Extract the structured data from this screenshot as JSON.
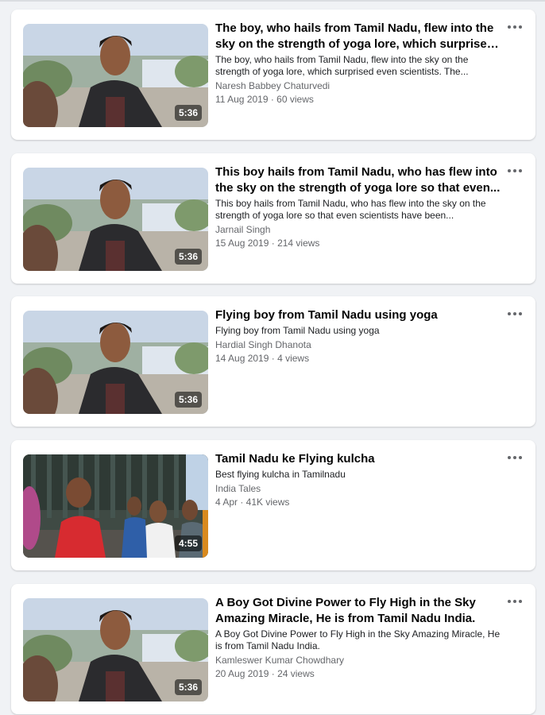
{
  "videos": [
    {
      "title": "The boy, who hails from Tamil Nadu, flew into the sky on the strength of yoga lore, which surprised even...",
      "description": "The boy, who hails from Tamil Nadu, flew into the sky on the strength of yoga lore, which surprised even scientists. The...",
      "author": "Naresh Babbey Chaturvedi",
      "meta": "11 Aug 2019 · 60 views",
      "duration": "5:36"
    },
    {
      "title": "This boy hails from Tamil Nadu, who has flew into the sky on the strength of yoga lore so that even...",
      "description": "This boy hails from Tamil Nadu, who has flew into the sky on the strength of yoga lore so that even scientists have been...",
      "author": "Jarnail Singh",
      "meta": "15 Aug 2019 · 214 views",
      "duration": "5:36"
    },
    {
      "title": "Flying boy from Tamil Nadu using yoga",
      "description": "Flying boy from Tamil Nadu using yoga",
      "author": "Hardial Singh Dhanota",
      "meta": "14 Aug 2019 · 4 views",
      "duration": "5:36"
    },
    {
      "title": "Tamil Nadu ke Flying kulcha",
      "description": "Best flying kulcha in Tamilnadu",
      "author": "India Tales",
      "meta": "4 Apr · 41K views",
      "duration": "4:55"
    },
    {
      "title": "A Boy Got Divine Power to Fly High in the Sky Amazing Miracle, He is from Tamil Nadu India.",
      "description": "A Boy Got Divine Power to Fly High in the Sky Amazing Miracle, He is from Tamil Nadu India.",
      "author": "Kamleswer Kumar Chowdhary",
      "meta": "20 Aug 2019 · 24 views",
      "duration": "5:36"
    }
  ],
  "more_icon": "more-horizontal-icon"
}
